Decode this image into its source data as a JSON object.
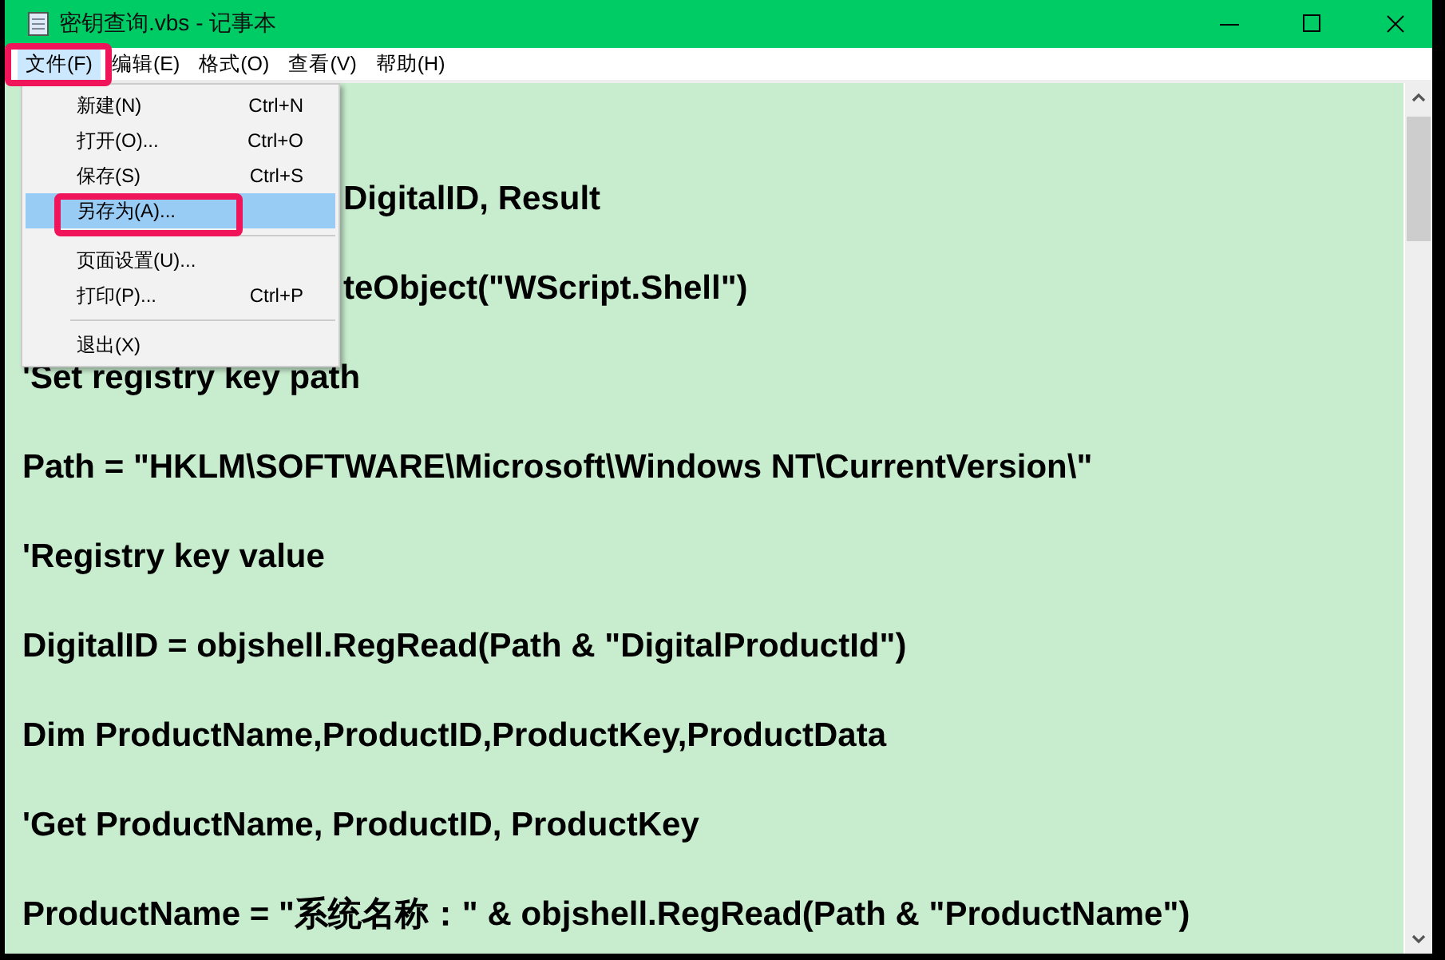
{
  "window": {
    "title": "密钥查询.vbs - 记事本"
  },
  "menubar": [
    {
      "label": "文件(F)",
      "selected": true
    },
    {
      "label": "编辑(E)",
      "selected": false
    },
    {
      "label": "格式(O)",
      "selected": false
    },
    {
      "label": "查看(V)",
      "selected": false
    },
    {
      "label": "帮助(H)",
      "selected": false
    }
  ],
  "file_menu": [
    {
      "kind": "item",
      "label": "新建(N)",
      "shortcut": "Ctrl+N",
      "selected": false
    },
    {
      "kind": "item",
      "label": "打开(O)...",
      "shortcut": "Ctrl+O",
      "selected": false
    },
    {
      "kind": "item",
      "label": "保存(S)",
      "shortcut": "Ctrl+S",
      "selected": false
    },
    {
      "kind": "item",
      "label": "另存为(A)...",
      "selected": true
    },
    {
      "kind": "separator"
    },
    {
      "kind": "item",
      "label": "页面设置(U)...",
      "selected": false
    },
    {
      "kind": "item",
      "label": "打印(P)...",
      "shortcut": "Ctrl+P",
      "selected": false
    },
    {
      "kind": "separator"
    },
    {
      "kind": "item",
      "label": "退出(X)",
      "selected": false
    }
  ],
  "editor": {
    "lines": [
      {
        "kind": "blank"
      },
      {
        "kind": "covered",
        "text": "DigitalID, Result"
      },
      {
        "kind": "covered",
        "text": "teObject(\"WScript.Shell\")"
      },
      {
        "kind": "full",
        "text": "'Set registry key path"
      },
      {
        "kind": "full",
        "text": "Path = \"HKLM\\SOFTWARE\\Microsoft\\Windows NT\\CurrentVersion\\\""
      },
      {
        "kind": "full",
        "text": "'Registry key value"
      },
      {
        "kind": "full",
        "text": "DigitalID = objshell.RegRead(Path & \"DigitalProductId\")"
      },
      {
        "kind": "full",
        "text": "Dim ProductName,ProductID,ProductKey,ProductData"
      },
      {
        "kind": "full",
        "text": "'Get ProductName, ProductID, ProductKey"
      },
      {
        "kind": "full",
        "text": "ProductName = \"系统名称：\" & objshell.RegRead(Path & \"ProductName\")"
      }
    ]
  }
}
